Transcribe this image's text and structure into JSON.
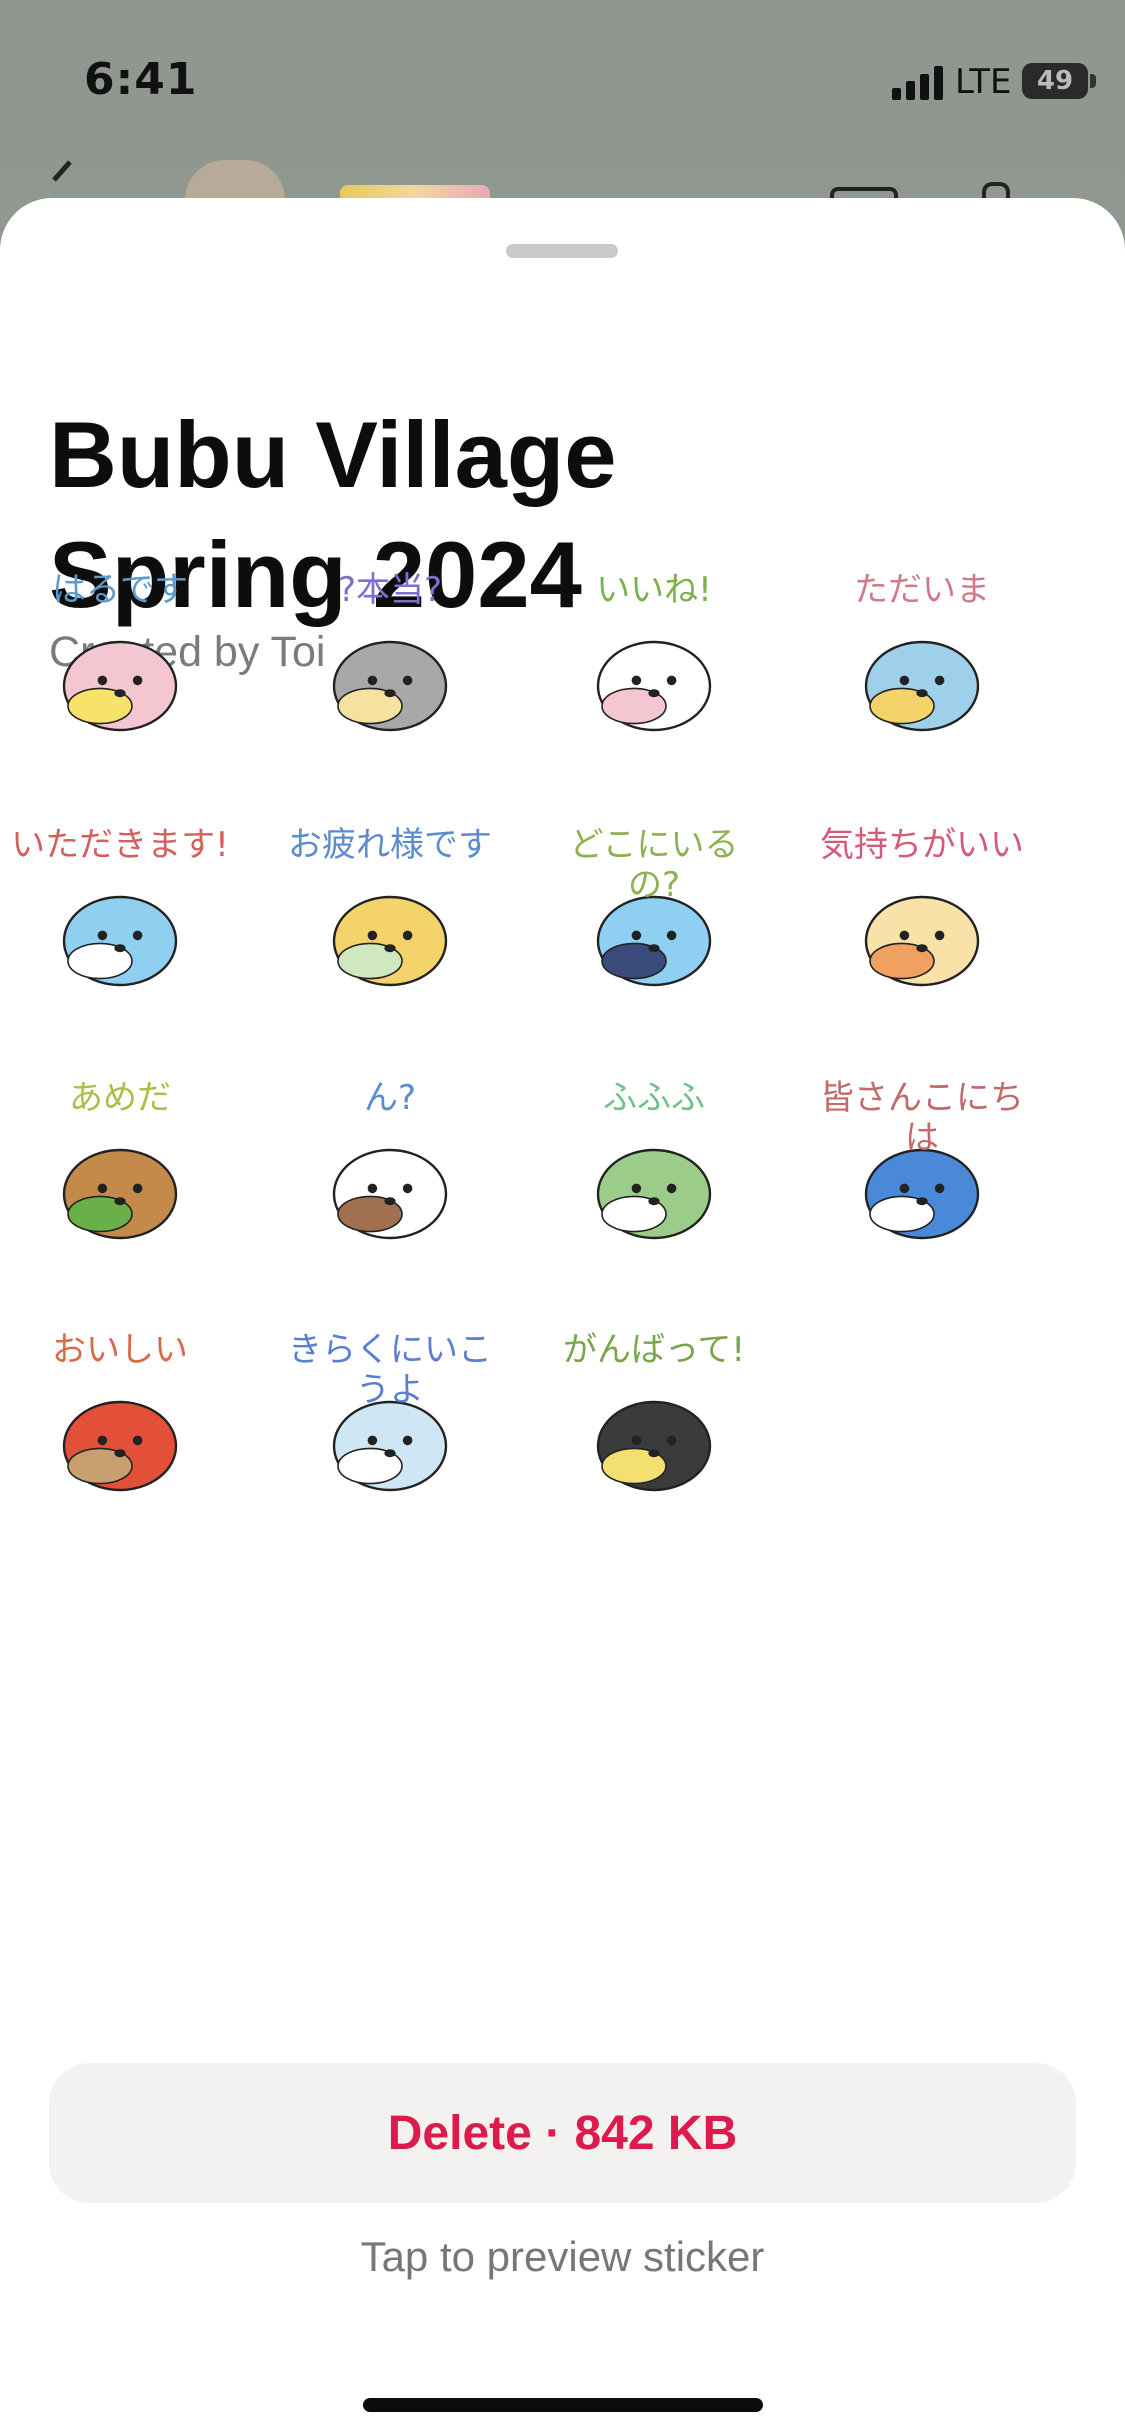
{
  "status_bar": {
    "time": "6:41",
    "network": "LTE",
    "battery": "49"
  },
  "sheet": {
    "title_line1": "Bubu Village",
    "title_line2": "Spring 2024",
    "creator": "Created by Toi"
  },
  "stickers": [
    {
      "caption": "はるです",
      "color": "#5a9ccf",
      "art": "pink-hood-seal"
    },
    {
      "caption": "?本当?",
      "color": "#7d6fd0",
      "art": "gray-bear"
    },
    {
      "caption": "いいね!",
      "color": "#7bb24a",
      "art": "white-horse"
    },
    {
      "caption": "ただいま",
      "color": "#d07a8a",
      "art": "blue-fish-house"
    },
    {
      "caption": "いただきます!",
      "color": "#d4605c",
      "art": "whale-cake"
    },
    {
      "caption": "お疲れ様です",
      "color": "#5a8ccf",
      "art": "sleeping-bear"
    },
    {
      "caption": "どこにいるの?",
      "color": "#8fb250",
      "art": "blue-phone"
    },
    {
      "caption": "気持ちがいい",
      "color": "#d45a7a",
      "art": "yellow-blob"
    },
    {
      "caption": "あめだ",
      "color": "#a8c048",
      "art": "leaf-rain"
    },
    {
      "caption": "ん?",
      "color": "#5a8ccf",
      "art": "white-dog"
    },
    {
      "caption": "ふふふ",
      "color": "#6fc08a",
      "art": "lily-pad"
    },
    {
      "caption": "皆さんこにちは",
      "color": "#c26a6a",
      "art": "microphone-blue"
    },
    {
      "caption": "おいしい",
      "color": "#d86a4a",
      "art": "red-octopus"
    },
    {
      "caption": "きらくにいこうよ",
      "color": "#5a7fd0",
      "art": "astronaut-seal"
    },
    {
      "caption": "がんばって!",
      "color": "#7aa64a",
      "art": "penguin-flag"
    }
  ],
  "actions": {
    "delete_label": "Delete · 842 KB",
    "hint": "Tap to preview sticker"
  },
  "colors": {
    "delete": "#dd1a4b",
    "sheet_bg": "#ffffff"
  }
}
